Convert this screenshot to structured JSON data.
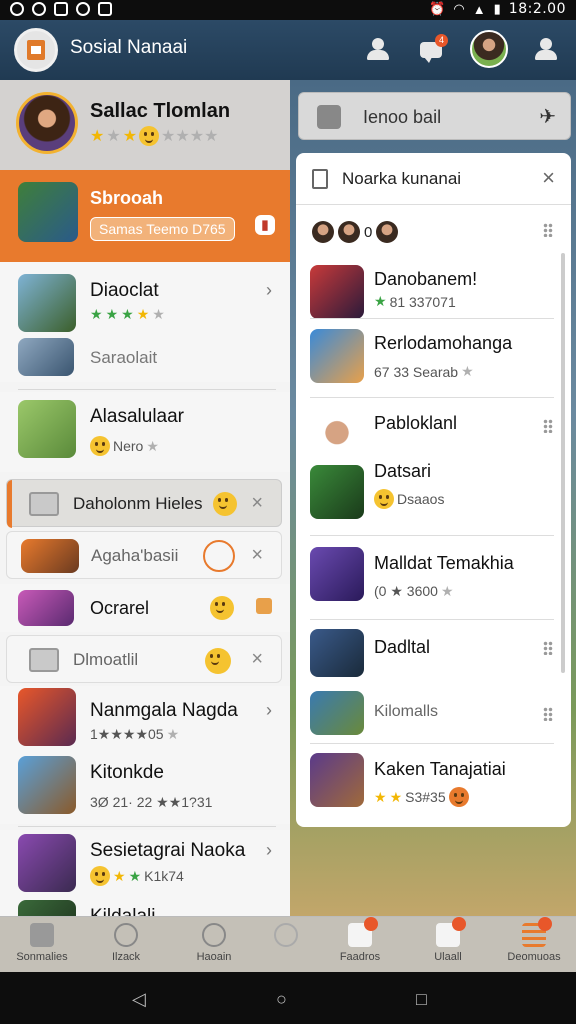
{
  "status_bar": {
    "time": "18:2.00"
  },
  "header": {
    "title": "Sosial Nanaai",
    "notification_count": "4"
  },
  "profile": {
    "name": "Sallac Tlomlan"
  },
  "featured": {
    "title": "Sbrooah",
    "tag": "Samas Teemo D765"
  },
  "left_list": {
    "items": [
      {
        "title": "Diaoclat"
      },
      {
        "title": "Saraolait"
      },
      {
        "title": "Alasalulaar",
        "sub": "Nero"
      },
      {
        "title": "Nanmgala Nagda",
        "sub": "1★★★★05"
      },
      {
        "title": "Kitonkde",
        "sub": "3Ø 21· 22 ★★1?31"
      },
      {
        "title": "Sesietagrai Naoka",
        "sub": "K1k74"
      },
      {
        "title": "Kildalali"
      }
    ],
    "toasts": [
      {
        "label": "Daholonm Hieles"
      },
      {
        "label": "Agaha'basii"
      },
      {
        "label": "Ocrarel"
      },
      {
        "label": "Dlmoatlil"
      }
    ]
  },
  "search": {
    "label": "Ienoo bail"
  },
  "notifications": {
    "title": "Noarka kunanai",
    "mini_count": "0",
    "items": [
      {
        "title": "Danobanem!",
        "sub": "81 337071"
      },
      {
        "title": "Rerlodamohanga",
        "sub": "67 33 Searab"
      },
      {
        "title": "Pabloklanl"
      },
      {
        "title": "Datsari",
        "sub": "Dsaaos"
      },
      {
        "title": "Malldat Temakhia",
        "sub": "(0 ★ 3600"
      },
      {
        "title": "Dadltal"
      },
      {
        "title": "Kilomalls"
      },
      {
        "title": "Kaken Tanajatiai",
        "sub": "S3#35"
      }
    ]
  },
  "bottom_nav": {
    "items": [
      {
        "label": "Sonmalies"
      },
      {
        "label": "Ilzack"
      },
      {
        "label": "Haoain"
      },
      {
        "label": ""
      },
      {
        "label": "Faadros"
      },
      {
        "label": "Ulaall"
      },
      {
        "label": "Deomuoas"
      }
    ]
  },
  "colors": {
    "accent": "#e87a2d",
    "header": "#2c4a66",
    "star": "#f2b705",
    "green_star": "#3aa344"
  }
}
